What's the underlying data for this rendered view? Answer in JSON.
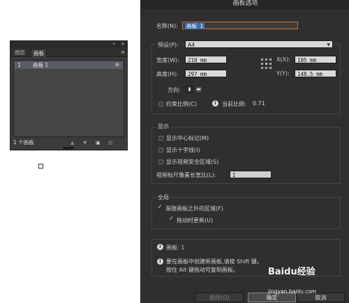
{
  "panel": {
    "tabs": [
      "图层",
      "画板"
    ],
    "active_tab": "画板",
    "top_controls": [
      "«",
      "×"
    ],
    "menu_icon": "≡",
    "rows": [
      {
        "number": "1",
        "name": "画板 1",
        "options_icon": "artboard-options-icon"
      }
    ],
    "count_label": "1 个画板",
    "bottom_icons": [
      "move-up-icon",
      "move-down-icon",
      "new-artboard-icon",
      "delete-artboard-icon"
    ]
  },
  "dialog": {
    "title": "画板选项",
    "name_label": "名称(N):",
    "name_value": "画板 1",
    "preset_label": "预设(P):",
    "preset_value": "A4",
    "width_label": "宽度(W):",
    "width_value": "210 mm",
    "height_label": "高度(H):",
    "height_value": "297 mm",
    "x_label": "X(X):",
    "x_value": "105 mm",
    "y_label": "Y(Y):",
    "y_value": "148.5 mm",
    "orientation_label": "方向:",
    "constrain_label": "约束比例(C)",
    "current_ratio_label": "当前比例:",
    "current_ratio_value": "0.71",
    "display_section": "显示",
    "show_center_mark": "显示中心标记(M)",
    "show_cross_hairs": "显示十字线(I)",
    "show_video_safe": "显示视频安全区域(S)",
    "pixel_aspect_label": "视频标尺像素长宽比(L):",
    "pixel_aspect_value": "1",
    "global_section": "全局",
    "fade_outside": "渐隐画板之外的区域(F)",
    "update_while_drag": "拖动时更新(U)",
    "artboards_info": "画板: 1",
    "shift_tip": "要在画板中创建新画板,请按 Shift 键。",
    "alt_tip": "按住 Alt 键拖动可复制画板。",
    "delete_button": "删除(D)",
    "ok_button": "确定",
    "cancel_button": "取消"
  },
  "watermark": {
    "brand": "Baidu经验",
    "url": "jingyan.baidu.com"
  }
}
